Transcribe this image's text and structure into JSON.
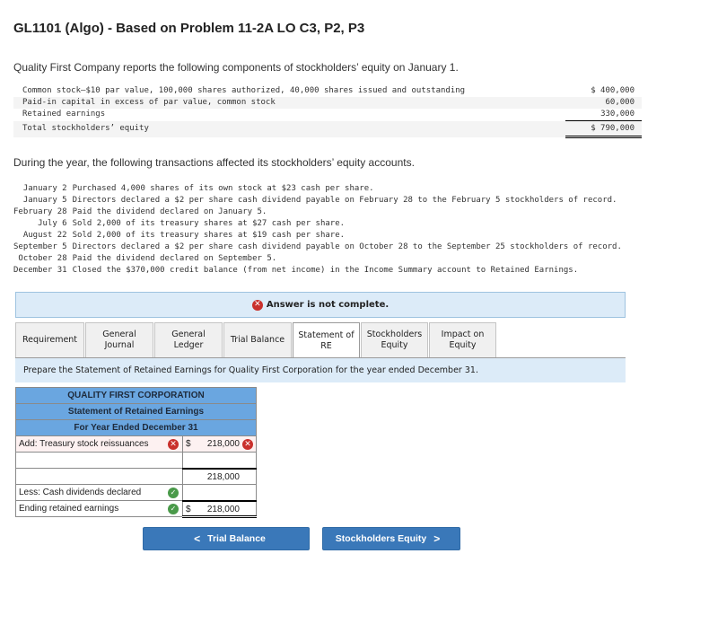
{
  "title": "GL1101 (Algo) - Based on Problem 11-2A LO C3, P2, P3",
  "intro": "Quality First Company reports the following components of stockholders’ equity on January 1.",
  "equity_components": [
    {
      "label": "Common stock—$10 par value, 100,000 shares authorized, 40,000 shares issued and outstanding",
      "amount": "$ 400,000"
    },
    {
      "label": "Paid-in capital in excess of par value, common stock",
      "amount": "60,000"
    },
    {
      "label": "Retained earnings",
      "amount": "330,000"
    },
    {
      "label": "Total stockholders’ equity",
      "amount": "$ 790,000"
    }
  ],
  "transactions_intro": "During the year, the following transactions affected its stockholders’ equity accounts.",
  "transactions": [
    {
      "date": "January 2",
      "text": "Purchased 4,000 shares of its own stock at $23 cash per share."
    },
    {
      "date": "January 5",
      "text": "Directors declared a $2 per share cash dividend payable on February 28 to the February 5 stockholders of record."
    },
    {
      "date": "February 28",
      "text": "Paid the dividend declared on January 5."
    },
    {
      "date": "July 6",
      "text": "Sold 2,000 of its treasury shares at $27 cash per share."
    },
    {
      "date": "August 22",
      "text": "Sold 2,000 of its treasury shares at $19 cash per share."
    },
    {
      "date": "September 5",
      "text": "Directors declared a $2 per share cash dividend payable on October 28 to the September 25 stockholders of record."
    },
    {
      "date": "October 28",
      "text": "Paid the dividend declared on September 5."
    },
    {
      "date": "December 31",
      "text": "Closed the $370,000 credit balance (from net income) in the Income Summary account to Retained Earnings."
    }
  ],
  "answer_status": "Answer is not complete.",
  "tabs": [
    {
      "label": "Requirement",
      "active": false
    },
    {
      "label": "General Journal",
      "active": false
    },
    {
      "label": "General Ledger",
      "active": false
    },
    {
      "label": "Trial Balance",
      "active": false
    },
    {
      "label": "Statement of RE",
      "active": true
    },
    {
      "label": "Stockholders Equity",
      "active": false
    },
    {
      "label": "Impact on Equity",
      "active": false
    }
  ],
  "instruction": "Prepare the Statement of Retained Earnings for Quality First Corporation for the year ended December 31.",
  "statement": {
    "company": "QUALITY FIRST CORPORATION",
    "name": "Statement of Retained Earnings",
    "period": "For Year Ended December 31",
    "rows": [
      {
        "label": "Add: Treasury stock reissuances",
        "label_status": "incorrect",
        "dollar": "$",
        "value": "218,000",
        "value_status": "incorrect"
      },
      {
        "label": "",
        "dollar": "",
        "value": ""
      },
      {
        "label": "",
        "dollar": "",
        "value": "218,000"
      },
      {
        "label": "Less: Cash dividends declared",
        "label_status": "correct",
        "dollar": "",
        "value": ""
      },
      {
        "label": "Ending retained earnings",
        "label_status": "correct",
        "dollar": "$",
        "value": "218,000"
      }
    ]
  },
  "nav": {
    "prev_label": "Trial Balance",
    "next_label": "Stockholders Equity"
  },
  "colors": {
    "header_blue": "#6aa6e0",
    "button_blue": "#3a78b9",
    "error_red": "#c9302c",
    "correct_green": "#4a9a4a",
    "info_bg": "#dcebf8"
  }
}
